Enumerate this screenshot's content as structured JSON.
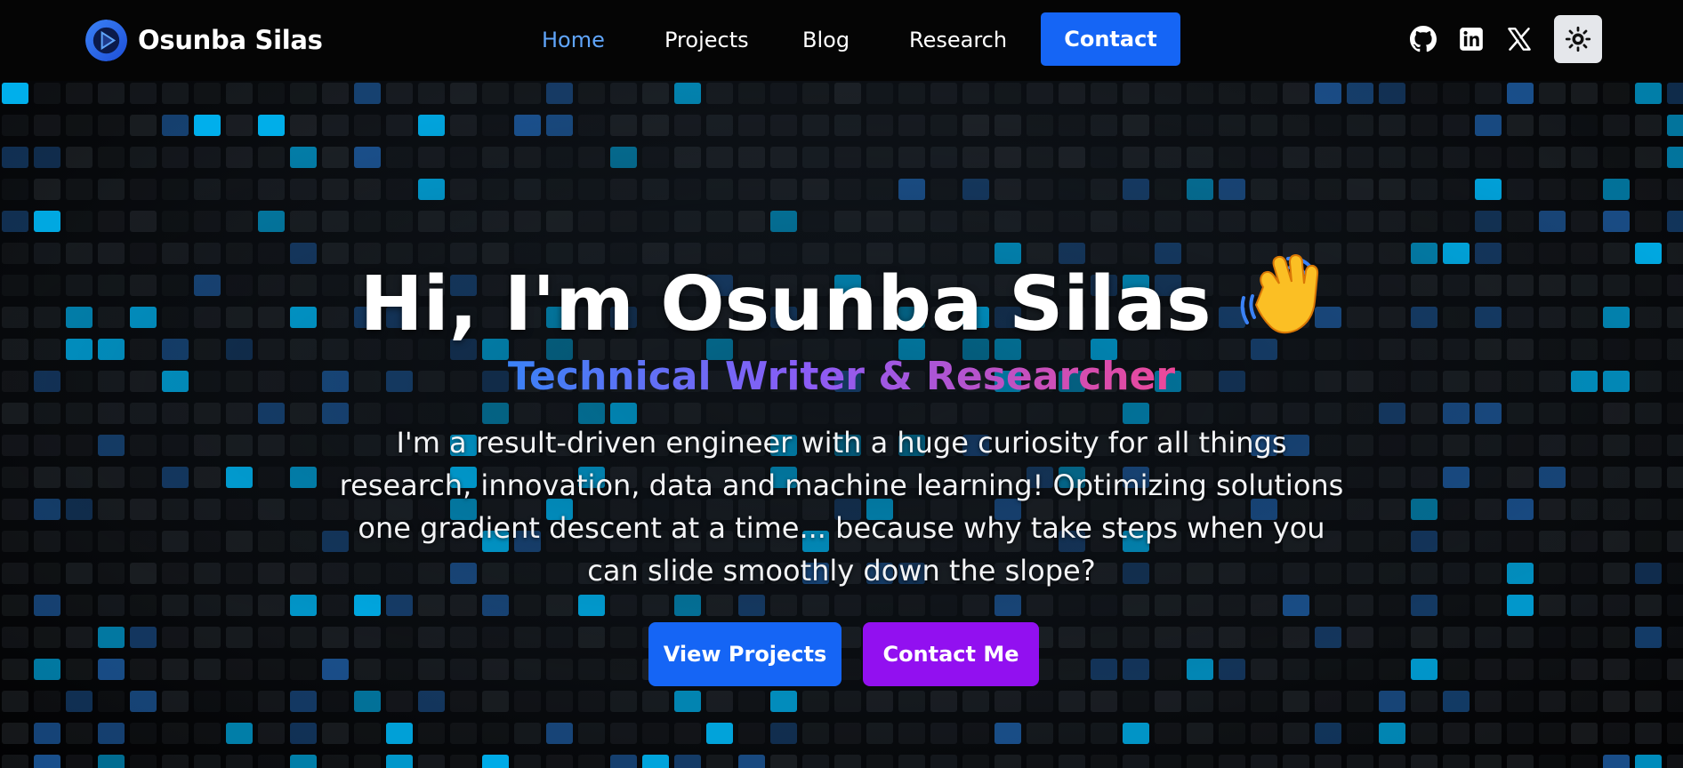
{
  "brand": {
    "name": "Osunba Silas"
  },
  "nav": {
    "links": [
      {
        "label": "Home",
        "active": true
      },
      {
        "label": "Projects",
        "active": false
      },
      {
        "label": "Blog",
        "active": false
      },
      {
        "label": "Research",
        "active": false
      }
    ],
    "contact_label": "Contact",
    "icons": [
      "github-icon",
      "linkedin-icon",
      "x-icon",
      "sun-icon"
    ]
  },
  "hero": {
    "title": "Hi, I'm Osunba Silas",
    "subtitle": "Technical Writer & Researcher",
    "bio": "I'm a result-driven engineer with a huge curiosity for all things research, innovation, data and machine learning! Optimizing solutions one gradient descent at a time... because why take steps when you can slide smoothly down the slope?",
    "primary_button": "View Projects",
    "secondary_button": "Contact Me",
    "emoji": "waving-hand"
  },
  "colors": {
    "accent_blue": "#1565f5",
    "accent_purple": "#9210f0",
    "active_link": "#60a5fa",
    "nav_bg": "#050505"
  }
}
